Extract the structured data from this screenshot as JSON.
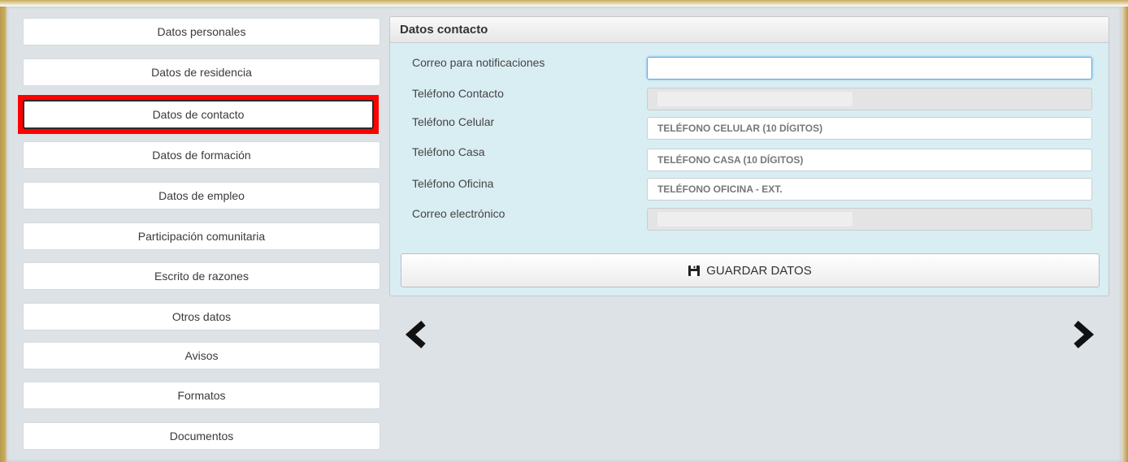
{
  "sidebar": {
    "items": [
      {
        "label": "Datos personales"
      },
      {
        "label": "Datos de residencia"
      },
      {
        "label": "Datos de contacto",
        "active": true
      },
      {
        "label": "Datos de formación"
      },
      {
        "label": "Datos de empleo"
      },
      {
        "label": "Participación comunitaria"
      },
      {
        "label": "Escrito de razones"
      },
      {
        "label": "Otros datos"
      },
      {
        "label": "Avisos"
      },
      {
        "label": "Formatos"
      },
      {
        "label": "Documentos"
      }
    ]
  },
  "panel": {
    "title": "Datos contacto",
    "fields": [
      {
        "label": "Correo para notificaciones",
        "value": "",
        "placeholder": ""
      },
      {
        "label": "Teléfono Contacto",
        "value": "",
        "placeholder": ""
      },
      {
        "label": "Teléfono Celular",
        "value": "",
        "placeholder": "TELÉFONO CELULAR (10 DÍGITOS)"
      },
      {
        "label": "Teléfono Casa",
        "value": "",
        "placeholder": "TELÉFONO CASA (10 DÍGITOS)"
      },
      {
        "label": "Teléfono Oficina",
        "value": "",
        "placeholder": "TELÉFONO OFICINA - EXT."
      },
      {
        "label": "Correo electrónico",
        "value": "",
        "placeholder": ""
      }
    ],
    "save_label": "GUARDAR DATOS"
  },
  "nav": {
    "prev_icon": "chevron-left-icon",
    "next_icon": "chevron-right-icon"
  },
  "colors": {
    "highlight": "#ff0000",
    "panel_bg": "#d9eef3",
    "canvas_bg": "#dde2e6"
  }
}
